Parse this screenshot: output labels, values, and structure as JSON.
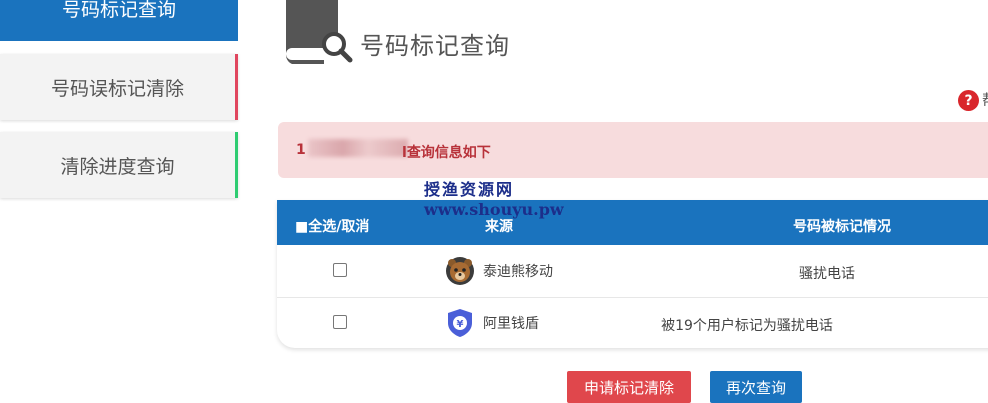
{
  "sidebar": {
    "items": [
      {
        "label": "号码标记查询"
      },
      {
        "label": "号码误标记清除"
      },
      {
        "label": "清除进度查询"
      }
    ]
  },
  "header": {
    "title": "号码标记查询",
    "help_icon": "question-icon",
    "help_text_partial": "帮"
  },
  "alert": {
    "number_prefix": "1",
    "number_suffix": "l",
    "message": "查询信息如下"
  },
  "watermark": {
    "line1": "授渔资源网",
    "line2": "www.shouyu.pw"
  },
  "table": {
    "columns": [
      "■全选/取消",
      "来源",
      "号码被标记情况"
    ],
    "rows": [
      {
        "source": "泰迪熊移动",
        "source_icon": "teddy-bear-icon",
        "status": "骚扰电话"
      },
      {
        "source": "阿里钱盾",
        "source_icon": "shield-yen-icon",
        "status": "被19个用户标记为骚扰电话"
      }
    ]
  },
  "buttons": {
    "clear": "申请标记清除",
    "again": "再次查询"
  },
  "colors": {
    "primary": "#1a73be",
    "danger": "#e0474c",
    "alert_bg": "#f7dcdd",
    "alert_text": "#b8323a"
  }
}
